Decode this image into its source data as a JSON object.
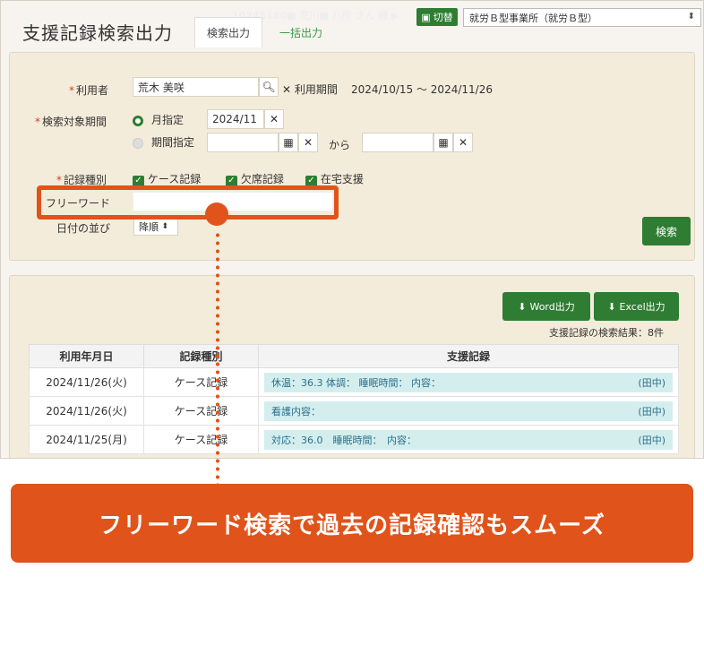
{
  "header": {
    "title": "支援記録検索出力",
    "faded_text": "10245180■ 荒川■ 八所 さん 様 ▶",
    "switch_label": "切替",
    "office_select": "就労Ｂ型事業所（就労Ｂ型）",
    "tabs": [
      {
        "label": "検索出力"
      },
      {
        "label": "一括出力"
      }
    ]
  },
  "form": {
    "user_label": "利用者",
    "user_value": "荒木 美咲",
    "usage_label": "利用期間",
    "usage_value": "2024/10/15 ～ 2024/11/26",
    "period_label": "検索対象期間",
    "month_label": "月指定",
    "month_value": "2024/11",
    "range_label": "期間指定",
    "kara": "から",
    "record_type_label": "記録種別",
    "types": [
      "ケース記録",
      "欠席記録",
      "在宅支援"
    ],
    "freeword_label": "フリーワード",
    "freeword_value": "",
    "sort_label": "日付の並び",
    "sort_value": "降順",
    "search_button": "検索",
    "required_mark": "*"
  },
  "results": {
    "word_button": "Word出力",
    "excel_button": "Excel出力",
    "count_text": "支援記録の検索結果：8件",
    "columns": [
      "利用年月日",
      "記録種別",
      "支援記録"
    ],
    "rows": [
      {
        "date": "2024/11/26(火)",
        "type": "ケース記録",
        "record": "休温：36.3 体調： 睡眠時間： 内容：",
        "staff": "(田中)"
      },
      {
        "date": "2024/11/26(火)",
        "type": "ケース記録",
        "record": "看護内容：",
        "staff": "(田中)"
      },
      {
        "date": "2024/11/25(月)",
        "type": "ケース記録",
        "record": "対応：36.0　睡眠時間：　内容：",
        "staff": "(田中)"
      }
    ]
  },
  "banner": {
    "text": "フリーワード検索で過去の記録確認もスムーズ"
  },
  "colors": {
    "accent": "#e0531a",
    "green": "#2e7d32",
    "panel": "#f4ecda"
  }
}
